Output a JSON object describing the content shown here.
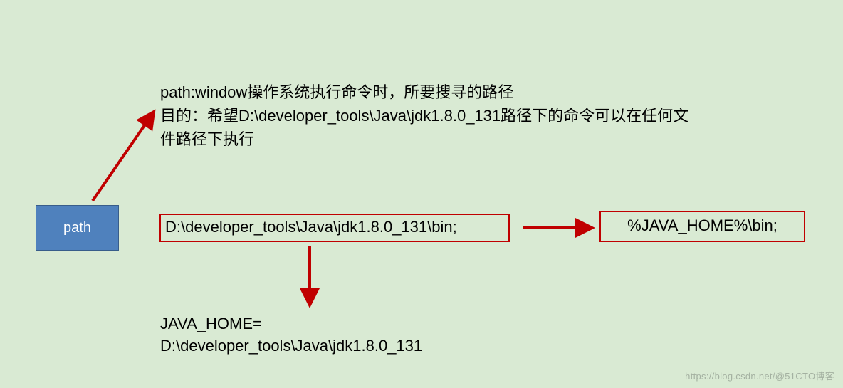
{
  "path_label": "path",
  "description": {
    "line1": "path:window操作系统执行命令时，所要搜寻的路径",
    "line2": "目的：希望D:\\developer_tools\\Java\\jdk1.8.0_131路径下的命令可以在任何文件路径下执行"
  },
  "full_path_value": "D:\\developer_tools\\Java\\jdk1.8.0_131\\bin;",
  "env_path_value": "%JAVA_HOME%\\bin;",
  "java_home": {
    "line1": "JAVA_HOME=",
    "line2": "D:\\developer_tools\\Java\\jdk1.8.0_131"
  },
  "watermark": "https://blog.csdn.net/@51CTO博客",
  "colors": {
    "background": "#d9ead3",
    "box_fill": "#4f81bd",
    "box_border": "#385d8a",
    "arrow": "#c00000",
    "red_border": "#c00000"
  }
}
